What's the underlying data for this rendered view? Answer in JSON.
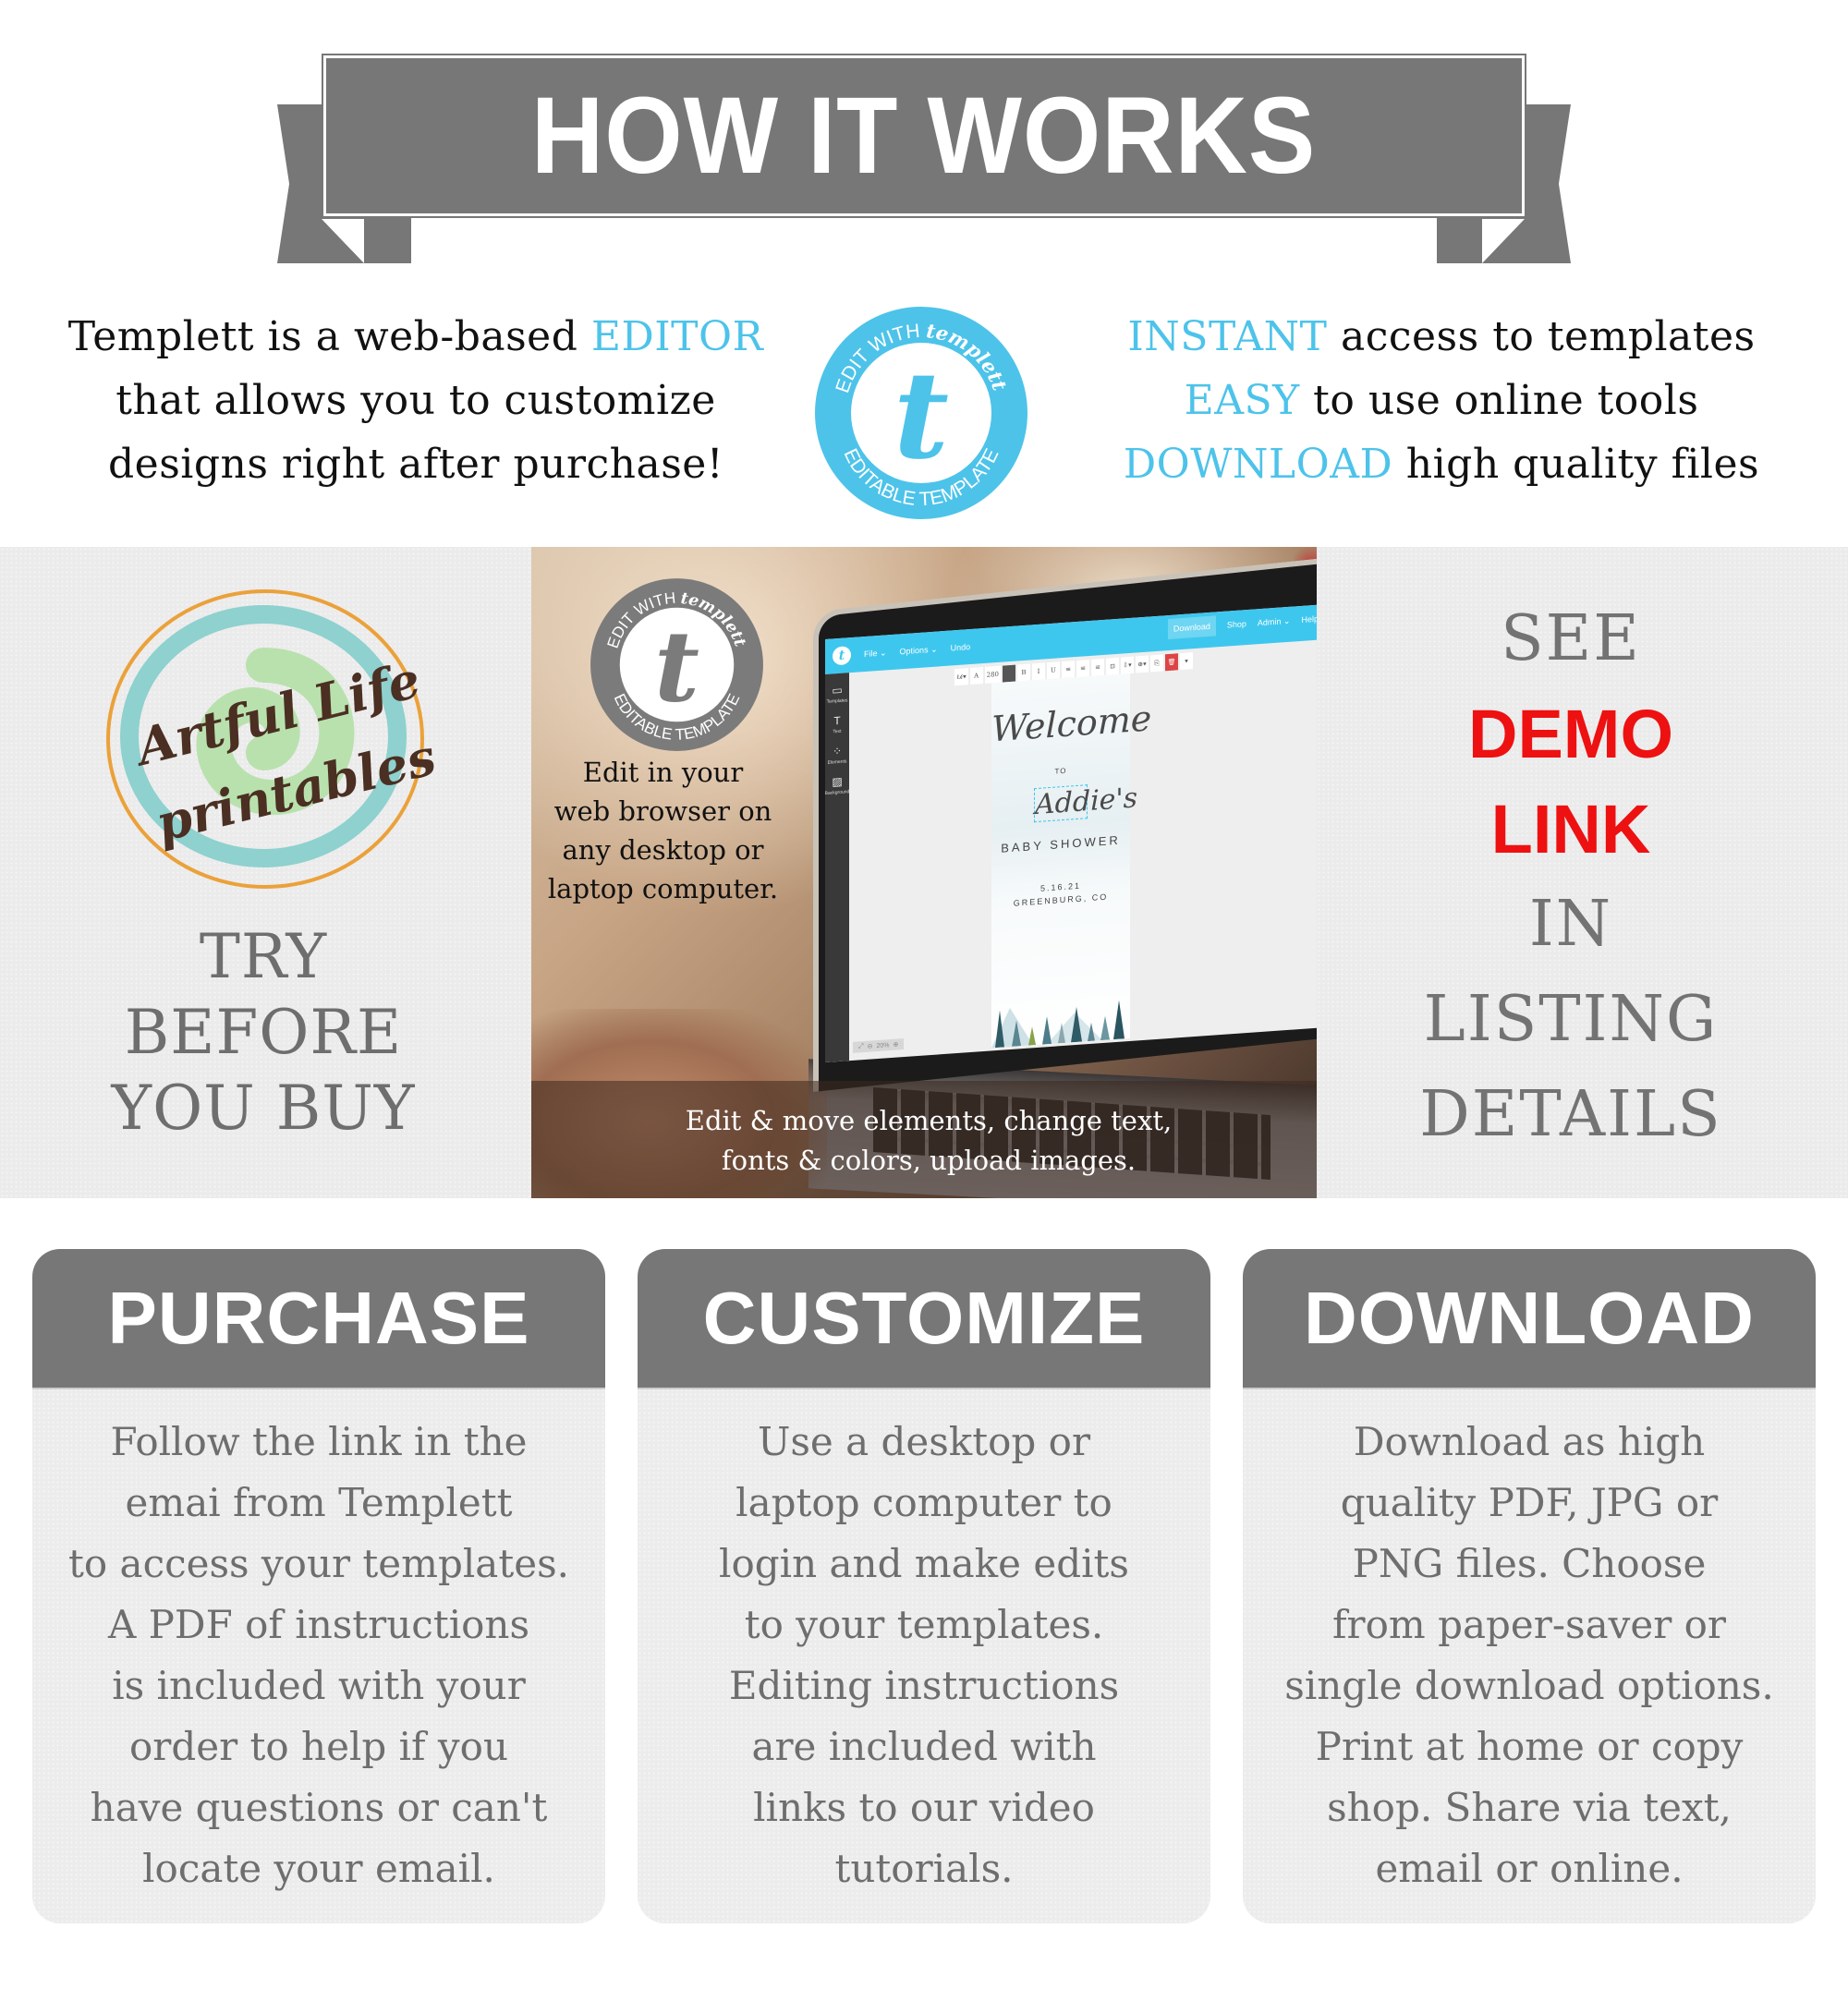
{
  "banner": {
    "title": "HOW IT WORKS"
  },
  "intro": {
    "left": {
      "line1_pre": "Templett is a web-based ",
      "line1_hl": "EDITOR",
      "line2": "that allows you to customize",
      "line3": "designs right after purchase!"
    },
    "right": [
      {
        "hl": "INSTANT",
        "text": " access to templates"
      },
      {
        "hl": "EASY",
        "text": " to use online tools"
      },
      {
        "hl": "DOWNLOAD",
        "text": " high quality files"
      }
    ],
    "badge": {
      "top_arc": "EDIT WITH",
      "brand": "templett",
      "letter": "t",
      "bottom_arc": "EDITABLE TEMPLATE",
      "color": "#4dc3ea"
    }
  },
  "middle": {
    "logo": {
      "line1": "Artful Life",
      "line2": "printables"
    },
    "try": [
      "TRY",
      "BEFORE",
      "YOU BUY"
    ],
    "see": {
      "line1": "SEE",
      "red1": "DEMO",
      "red2": "LINK",
      "line4": "IN",
      "line5": "LISTING",
      "line6": "DETAILS",
      "red_color": "#ee1111"
    },
    "photo": {
      "badge": {
        "top_arc": "EDIT WITH",
        "brand": "templett",
        "letter": "t",
        "bottom_arc": "EDITABLE TEMPLATE"
      },
      "edit_text": [
        "Edit in your",
        "web browser on",
        "any desktop or",
        "laptop computer."
      ],
      "caption": [
        "Edit & move elements, change text,",
        "fonts & colors, upload images."
      ],
      "editor": {
        "menu": [
          "File ⌄",
          "Options ⌄",
          "Undo"
        ],
        "right_menu": [
          "Download",
          "Shop",
          "Admin ⌄",
          "Help"
        ],
        "sidebar": [
          {
            "icon": "▭",
            "label": "Templates"
          },
          {
            "icon": "T",
            "label": "Text"
          },
          {
            "icon": "⁘",
            "label": "Elements"
          },
          {
            "icon": "▨",
            "label": "Background"
          }
        ],
        "toolbar": [
          "ℓ𝓀▾",
          "A",
          "280",
          "",
          "B",
          "I",
          "U",
          "≡",
          "≡",
          "≡",
          "⊡",
          "⇩▾",
          "⊕▾",
          "⎘",
          "🗑",
          "▾"
        ],
        "card": {
          "welcome": "Welcome",
          "to": "TO",
          "name": "Addie's",
          "event": "BABY SHOWER",
          "date": "5.16.21",
          "location": "GREENBURG, CO"
        },
        "zoom_level": "20%"
      }
    }
  },
  "steps": [
    {
      "title": "PURCHASE",
      "lines": [
        "Follow the link in the",
        "emai from Templett",
        "to access your templates.",
        "A PDF of instructions",
        "is included with your",
        "order to help if you",
        "have questions or can't",
        "locate your email."
      ]
    },
    {
      "title": "CUSTOMIZE",
      "lines": [
        "Use a desktop or",
        "laptop computer to",
        "login and make edits",
        "to your templates.",
        "Editing instructions",
        "are included with",
        "links to our video",
        "tutorials."
      ]
    },
    {
      "title": "DOWNLOAD",
      "lines": [
        "Download as high",
        "quality PDF, JPG or",
        "PNG files. Choose",
        "from paper-saver or",
        "single download options.",
        "Print at home or copy",
        "shop. Share via text,",
        "email or online."
      ]
    }
  ]
}
